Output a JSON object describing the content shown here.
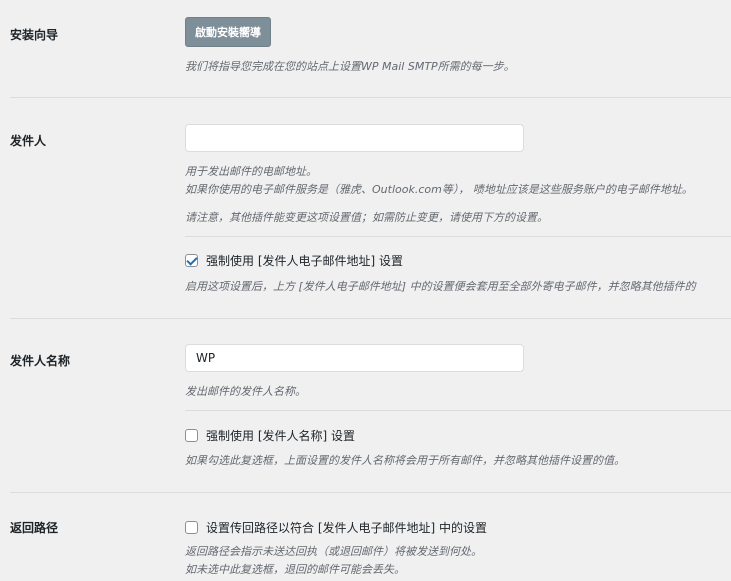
{
  "wizard": {
    "label": "安装向导",
    "button": "啟動安裝嚮導",
    "desc": "我们将指导您完成在您的站点上设置WP Mail SMTP所需的每一步。"
  },
  "from_email": {
    "label": "发件人",
    "value": "",
    "desc1": "用于发出邮件的电邮地址。",
    "desc2": "如果你使用的电子邮件服务是（雅虎、Outlook.com等），  啧地址应该是这些服务账户的电子邮件地址。",
    "desc3": "请注意，其他插件能变更这项设置值；如需防止变更，请使用下方的设置。",
    "force_checked": true,
    "force_label": "强制使用 [发件人电子邮件地址] 设置",
    "force_desc": "启用这项设置后，上方 [发件人电子邮件地址] 中的设置便会套用至全部外寄电子邮件，并忽略其他插件的"
  },
  "from_name": {
    "label": "发件人名称",
    "value": "WP",
    "desc": "发出邮件的发件人名称。",
    "force_checked": false,
    "force_label": "强制使用 [发件人名称] 设置",
    "force_desc": "如果勾选此复选框，上面设置的发件人名称将会用于所有邮件，并忽略其他插件设置的值。"
  },
  "return_path": {
    "label": "返回路径",
    "checked": false,
    "cb_label": "设置传回路径以符合 [发件人电子邮件地址] 中的设置",
    "desc1": "返回路径会指示未送达回执（或退回邮件）将被发送到何处。",
    "desc2": "如未选中此复选框，退回的邮件可能会丢失。"
  }
}
